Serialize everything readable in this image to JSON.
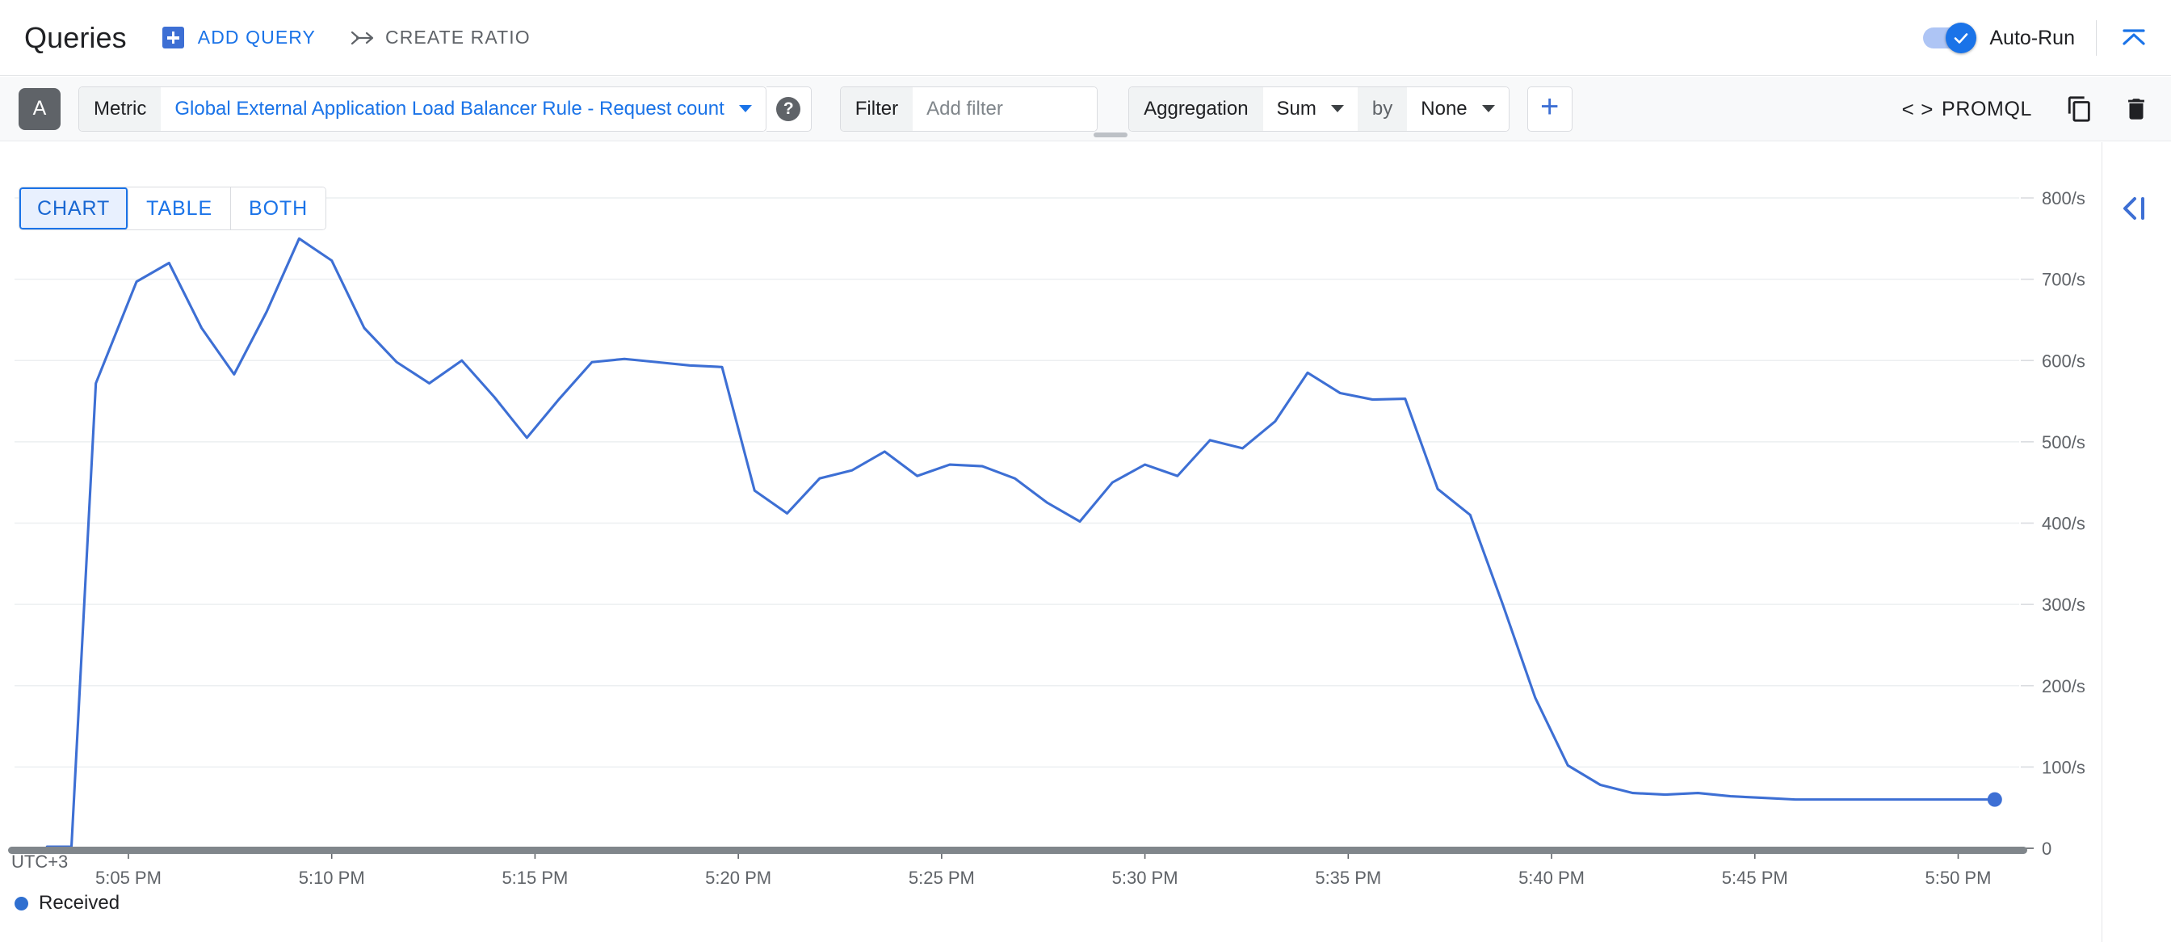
{
  "header": {
    "title": "Queries",
    "add_query_label": "ADD QUERY",
    "create_ratio_label": "CREATE RATIO",
    "autorun_label": "Auto-Run",
    "autorun_on": true,
    "add_query_icon": "plus-square-icon",
    "create_ratio_icon": "ratio-arrow-icon",
    "collapse_icon": "collapse-up-icon"
  },
  "query": {
    "badge": "A",
    "metric_label": "Metric",
    "metric_value": "Global External Application Load Balancer Rule - Request count",
    "help_icon": "help-circle-icon",
    "filter_label": "Filter",
    "filter_placeholder": "Add filter",
    "filter_value": "",
    "aggregation_label": "Aggregation",
    "aggregation_value": "Sum",
    "by_label": "by",
    "group_by_value": "None",
    "add_icon": "plus-icon",
    "promql_label": "PROMQL",
    "promql_icon": "code-brackets-icon",
    "duplicate_icon": "copy-icon",
    "delete_icon": "trash-icon"
  },
  "view_tabs": [
    {
      "label": "CHART",
      "active": true
    },
    {
      "label": "TABLE",
      "active": false
    },
    {
      "label": "BOTH",
      "active": false
    }
  ],
  "right_rail": {
    "collapse_icon": "collapse-panel-left-icon"
  },
  "accent_colors": {
    "primary_blue": "#1a73e8",
    "series_blue": "#3d6fd4",
    "tab_active_bg": "#e8f0fe",
    "badge_gray": "#5f6368",
    "toolbar_bg": "#f8f9fa"
  },
  "chart_data": {
    "type": "line",
    "title": "",
    "xlabel": "UTC+3",
    "ylabel": "",
    "ylim": [
      0,
      800
    ],
    "yticks": [
      0,
      100,
      200,
      300,
      400,
      500,
      600,
      700,
      800
    ],
    "ytick_labels": [
      "0",
      "100/s",
      "200/s",
      "300/s",
      "400/s",
      "500/s",
      "600/s",
      "700/s",
      "800/s"
    ],
    "xtick_labels": [
      "5:05 PM",
      "5:10 PM",
      "5:15 PM",
      "5:20 PM",
      "5:25 PM",
      "5:30 PM",
      "5:35 PM",
      "5:40 PM",
      "5:45 PM",
      "5:50 PM"
    ],
    "xtick_minutes": [
      305,
      310,
      315,
      320,
      325,
      330,
      335,
      340,
      345,
      350
    ],
    "xlim_minutes": [
      302.2,
      351.5
    ],
    "grid": true,
    "legend_position": "bottom-left",
    "timezone_label": "UTC+3",
    "units": "/s",
    "series": [
      {
        "name": "Received",
        "color": "#3d6fd4",
        "end_marker": true,
        "x_minutes": [
          303.0,
          303.6,
          304.2,
          305.2,
          306.0,
          306.8,
          307.6,
          308.4,
          309.2,
          310.0,
          310.8,
          311.6,
          312.4,
          313.2,
          314.0,
          314.8,
          315.6,
          316.4,
          317.2,
          318.0,
          318.8,
          319.6,
          320.4,
          321.2,
          322.0,
          322.8,
          323.6,
          324.4,
          325.2,
          326.0,
          326.8,
          327.6,
          328.4,
          329.2,
          330.0,
          330.8,
          331.6,
          332.4,
          333.2,
          334.0,
          334.8,
          335.6,
          336.4,
          337.2,
          338.0,
          338.8,
          339.6,
          340.4,
          341.2,
          342.0,
          342.8,
          343.6,
          344.4,
          345.2,
          346.0,
          346.8,
          347.6,
          348.4,
          349.2,
          350.0,
          350.9
        ],
        "values": [
          2,
          2,
          572,
          697,
          720,
          640,
          583,
          660,
          750,
          723,
          640,
          598,
          572,
          600,
          555,
          505,
          553,
          598,
          602,
          598,
          594,
          592,
          440,
          412,
          455,
          465,
          488,
          458,
          472,
          470,
          455,
          425,
          402,
          450,
          472,
          458,
          502,
          492,
          525,
          585,
          560,
          552,
          553,
          442,
          410,
          300,
          185,
          102,
          78,
          68,
          66,
          68,
          64,
          62,
          60,
          60,
          60,
          60,
          60,
          60,
          60
        ]
      }
    ]
  }
}
